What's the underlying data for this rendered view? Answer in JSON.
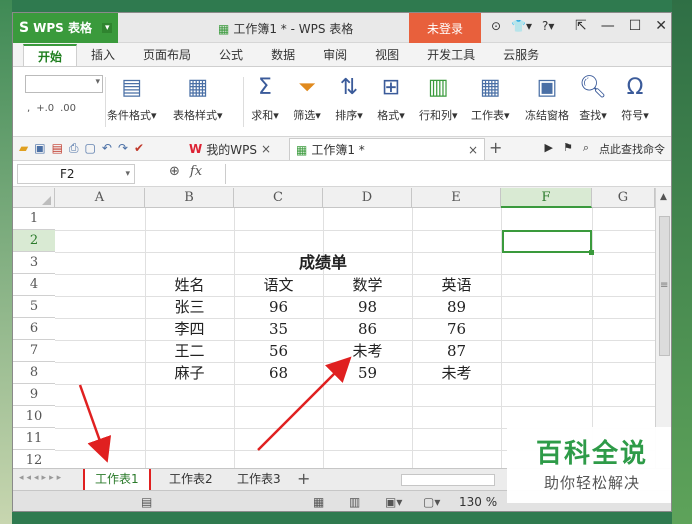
{
  "window": {
    "app_name": "WPS 表格",
    "doc_title": "工作簿1 * - WPS 表格",
    "login_label": "未登录",
    "title_icons": [
      "⊙",
      "👕▾",
      "?▾"
    ]
  },
  "menu": {
    "tabs": [
      "开始",
      "插入",
      "页面布局",
      "公式",
      "数据",
      "审阅",
      "视图",
      "开发工具",
      "云服务"
    ]
  },
  "ribbon": {
    "items": [
      {
        "label": "条件格式▾"
      },
      {
        "label": "表格样式▾"
      },
      {
        "label": "求和▾"
      },
      {
        "label": "筛选▾"
      },
      {
        "label": "排序▾"
      },
      {
        "label": "格式▾"
      },
      {
        "label": "行和列▾"
      },
      {
        "label": "工作表▾"
      },
      {
        "label": "冻结窗格"
      },
      {
        "label": "查找▾"
      },
      {
        "label": "符号▾"
      }
    ]
  },
  "quickbar": {
    "wps_tab": "我的WPS",
    "doc_tab": "工作簿1 *",
    "search_label": "点此查找命令"
  },
  "formula_bar": {
    "name_box": "F2",
    "fx": "fx",
    "formula": ""
  },
  "grid": {
    "columns": [
      "A",
      "B",
      "C",
      "D",
      "E",
      "F",
      "G"
    ],
    "rows": [
      "1",
      "2",
      "3",
      "4",
      "5",
      "6",
      "7",
      "8",
      "9",
      "10",
      "11",
      "12"
    ],
    "title": "成绩单",
    "headers": [
      "姓名",
      "语文",
      "数学",
      "英语"
    ],
    "records": [
      [
        "张三",
        "96",
        "98",
        "89"
      ],
      [
        "李四",
        "35",
        "86",
        "76"
      ],
      [
        "王二",
        "56",
        "未考",
        "87"
      ],
      [
        "麻子",
        "68",
        "59",
        "未考"
      ]
    ],
    "selected_cell": "F2"
  },
  "sheets": {
    "tabs": [
      "工作表1",
      "工作表2",
      "工作表3"
    ],
    "active": "工作表1"
  },
  "status": {
    "zoom": "130 %"
  },
  "watermark": {
    "title": "百科全说",
    "subtitle": "助你轻松解决"
  },
  "colors": {
    "accent": "#3a9a3c",
    "login": "#e8603c",
    "annotation": "#e02020"
  }
}
